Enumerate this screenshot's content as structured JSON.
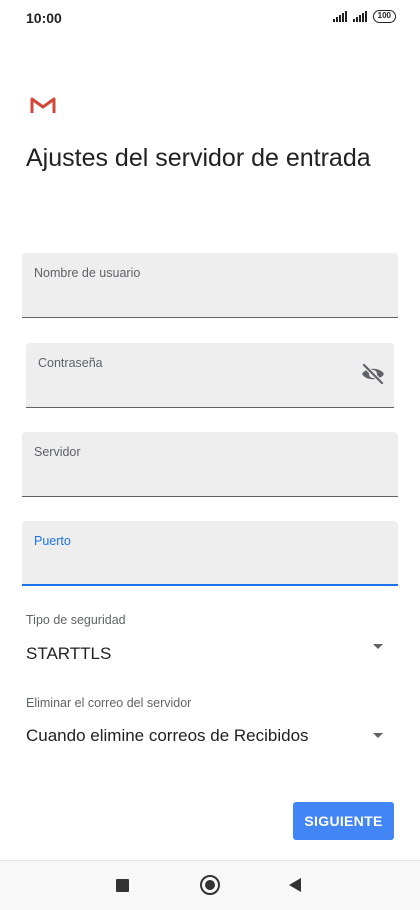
{
  "status_bar": {
    "time": "10:00",
    "battery": "100"
  },
  "header": {
    "logo_icon": "gmail-m-icon",
    "title": "Ajustes del servidor de entrada"
  },
  "form": {
    "username": {
      "label": "Nombre de usuario",
      "value": ""
    },
    "password": {
      "label": "Contraseña",
      "value": "",
      "toggle_icon": "eye-off-icon"
    },
    "server": {
      "label": "Servidor",
      "value": ""
    },
    "port": {
      "label": "Puerto",
      "value": "",
      "focused": true
    },
    "security_type": {
      "label": "Tipo de seguridad",
      "value": "STARTTLS"
    },
    "delete_mail": {
      "label": "Eliminar el correo del servidor",
      "value": "Cuando elimine correos de Recibidos"
    }
  },
  "actions": {
    "next_label": "SIGUIENTE"
  },
  "nav_bar": {
    "recents_icon": "square-icon",
    "home_icon": "circle-icon",
    "back_icon": "triangle-back-icon"
  },
  "colors": {
    "accent": "#1a73e8",
    "button": "#4285f4",
    "field_bg": "#eeeeee",
    "gmail_red": "#d44638"
  }
}
